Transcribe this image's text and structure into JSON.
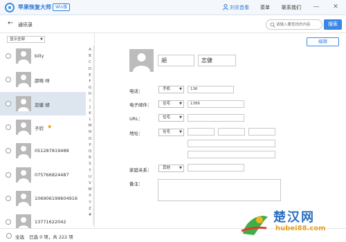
{
  "app": {
    "name": "苹果恢复大师",
    "edition": "Win版",
    "user_name": "刘衣首看",
    "menu_label": "菜单",
    "contact_label": "联系我们",
    "minimize": "—",
    "close": "✕"
  },
  "header": {
    "back": "←",
    "title": "通讯录",
    "search_placeholder": "请输入要查找的内容",
    "search_button": "搜索"
  },
  "sidebar": {
    "filter_value": "显示全部",
    "contacts": [
      {
        "name": "billy",
        "mark": ""
      },
      {
        "name": "邵晓  呀",
        "mark": ""
      },
      {
        "name": "志健  胡",
        "mark": ""
      },
      {
        "name": "子欣",
        "mark": "◆"
      },
      {
        "name": "051287819488",
        "mark": ""
      },
      {
        "name": "075766824487",
        "mark": ""
      },
      {
        "name": "106906199604916",
        "mark": ""
      },
      {
        "name": "13771622042",
        "mark": ""
      }
    ],
    "selected_index": 2,
    "alphabet": [
      "A",
      "B",
      "C",
      "D",
      "E",
      "F",
      "G",
      "H",
      "I",
      "J",
      "K",
      "L",
      "M",
      "N",
      "O",
      "P",
      "Q",
      "R",
      "S",
      "T",
      "U",
      "V",
      "W",
      "X",
      "Y",
      "Z",
      "#"
    ]
  },
  "footer": {
    "select_all": "全选",
    "selected_summary": "已选 0 项，共 222 项"
  },
  "detail": {
    "edit_button": "编辑",
    "last_name": "胡",
    "first_name": "志健",
    "phone_label": "电话：",
    "phone_type": "手机",
    "phone_value": "136",
    "email_label": "电子邮件：",
    "email_type": "住宅",
    "email_value": "1386",
    "url_label": "URL：",
    "url_type": "住宅",
    "address_label": "地址：",
    "address_type": "住宅",
    "family_label": "家庭关系：",
    "family_type": "其他",
    "note_label": "备注："
  },
  "watermark": {
    "title": "楚汉网",
    "url": "hubei88.com"
  },
  "colors": {
    "accent": "#3a86e6",
    "selected_row": "#dde5ef",
    "avatar_gray": "#b9b9b9"
  }
}
